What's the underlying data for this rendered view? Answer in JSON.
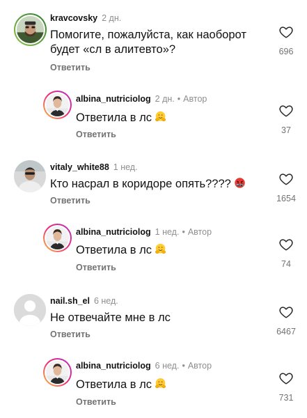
{
  "comments": [
    {
      "username": "kravcovsky",
      "time": "2 дн.",
      "text_line1": "Помогите, пожалуйста, как наоборот",
      "text_line2": "будет «сл в алитевто»?",
      "reply_label": "Ответить",
      "likes": "696",
      "is_reply": false
    },
    {
      "username": "albina_nutriciolog",
      "time": "2 дн.",
      "dot": "•",
      "author_label": "Автор",
      "text_line1": "Ответила в лс",
      "emoji": "hugging-face-emoji",
      "reply_label": "Ответить",
      "likes": "37",
      "is_reply": true
    },
    {
      "username": "vitaly_white88",
      "time": "1 нед.",
      "text_line1": "Кто насрал в коридоре опять????",
      "emoji": "cursing-face-emoji",
      "reply_label": "Ответить",
      "likes": "1654",
      "is_reply": false
    },
    {
      "username": "albina_nutriciolog",
      "time": "1 нед.",
      "dot": "•",
      "author_label": "Автор",
      "text_line1": "Ответила в лс",
      "emoji": "hugging-face-emoji",
      "reply_label": "Ответить",
      "likes": "74",
      "is_reply": true
    },
    {
      "username": "nail.sh_el",
      "time": "6 нед.",
      "text_line1": "Не отвечайте мне в лс",
      "reply_label": "Ответить",
      "likes": "6467",
      "is_reply": false
    },
    {
      "username": "albina_nutriciolog",
      "time": "6 нед.",
      "dot": "•",
      "author_label": "Автор",
      "text_line1": "Ответила в лс",
      "emoji": "hugging-face-emoji",
      "reply_label": "Ответить",
      "likes": "731",
      "is_reply": true
    }
  ],
  "colors": {
    "text": "#111111",
    "muted": "#8e8e8e",
    "reply": "#737373",
    "story_ring_start": "#f9a825",
    "story_ring_end": "#d81b9d",
    "default_avatar": "#c7c7c7"
  }
}
